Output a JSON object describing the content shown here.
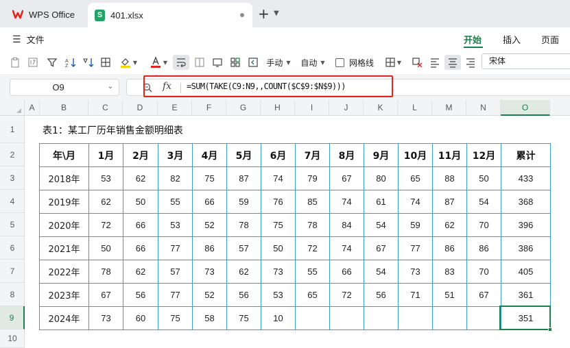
{
  "tabs": {
    "home_label": "WPS Office",
    "file_label": "401.xlsx",
    "add_label": "+"
  },
  "menu": {
    "file": "文件",
    "start": "开始",
    "insert": "插入",
    "page": "页面"
  },
  "toolbar": {
    "manual": "手动",
    "auto": "自动",
    "gridlines": "网格线",
    "font": "宋体"
  },
  "formula_bar": {
    "cell_ref": "O9",
    "fx": "fx",
    "formula": "=SUM(TAKE(C9:N9,,COUNT($C$9:$N$9)))"
  },
  "columns": [
    "A",
    "B",
    "C",
    "D",
    "E",
    "F",
    "G",
    "H",
    "I",
    "J",
    "K",
    "L",
    "M",
    "N",
    "O"
  ],
  "rows": [
    "1",
    "2",
    "3",
    "4",
    "5",
    "6",
    "7",
    "8",
    "9",
    "10"
  ],
  "sheet": {
    "title": "表1：某工厂历年销售金额明细表",
    "headers": [
      "年\\月",
      "1月",
      "2月",
      "3月",
      "4月",
      "5月",
      "6月",
      "7月",
      "8月",
      "9月",
      "10月",
      "11月",
      "12月",
      "累计"
    ],
    "rows": [
      [
        "2018年",
        "53",
        "62",
        "82",
        "75",
        "87",
        "74",
        "79",
        "67",
        "80",
        "65",
        "88",
        "50",
        "433"
      ],
      [
        "2019年",
        "62",
        "50",
        "55",
        "66",
        "59",
        "76",
        "85",
        "74",
        "61",
        "74",
        "87",
        "54",
        "368"
      ],
      [
        "2020年",
        "72",
        "66",
        "53",
        "52",
        "78",
        "75",
        "78",
        "84",
        "54",
        "59",
        "62",
        "70",
        "396"
      ],
      [
        "2021年",
        "50",
        "66",
        "77",
        "86",
        "57",
        "50",
        "72",
        "74",
        "67",
        "77",
        "86",
        "86",
        "386"
      ],
      [
        "2022年",
        "78",
        "62",
        "57",
        "73",
        "62",
        "73",
        "55",
        "66",
        "54",
        "73",
        "83",
        "70",
        "405"
      ],
      [
        "2023年",
        "67",
        "56",
        "77",
        "52",
        "56",
        "53",
        "65",
        "72",
        "56",
        "71",
        "51",
        "67",
        "361"
      ],
      [
        "2024年",
        "73",
        "60",
        "75",
        "58",
        "75",
        "10",
        "",
        "",
        "",
        "",
        "",
        "",
        "351"
      ]
    ]
  },
  "colors": {
    "accent": "#1a7f4b",
    "highlight_box": "#e0241f",
    "table_border": "#3aa0c6"
  }
}
